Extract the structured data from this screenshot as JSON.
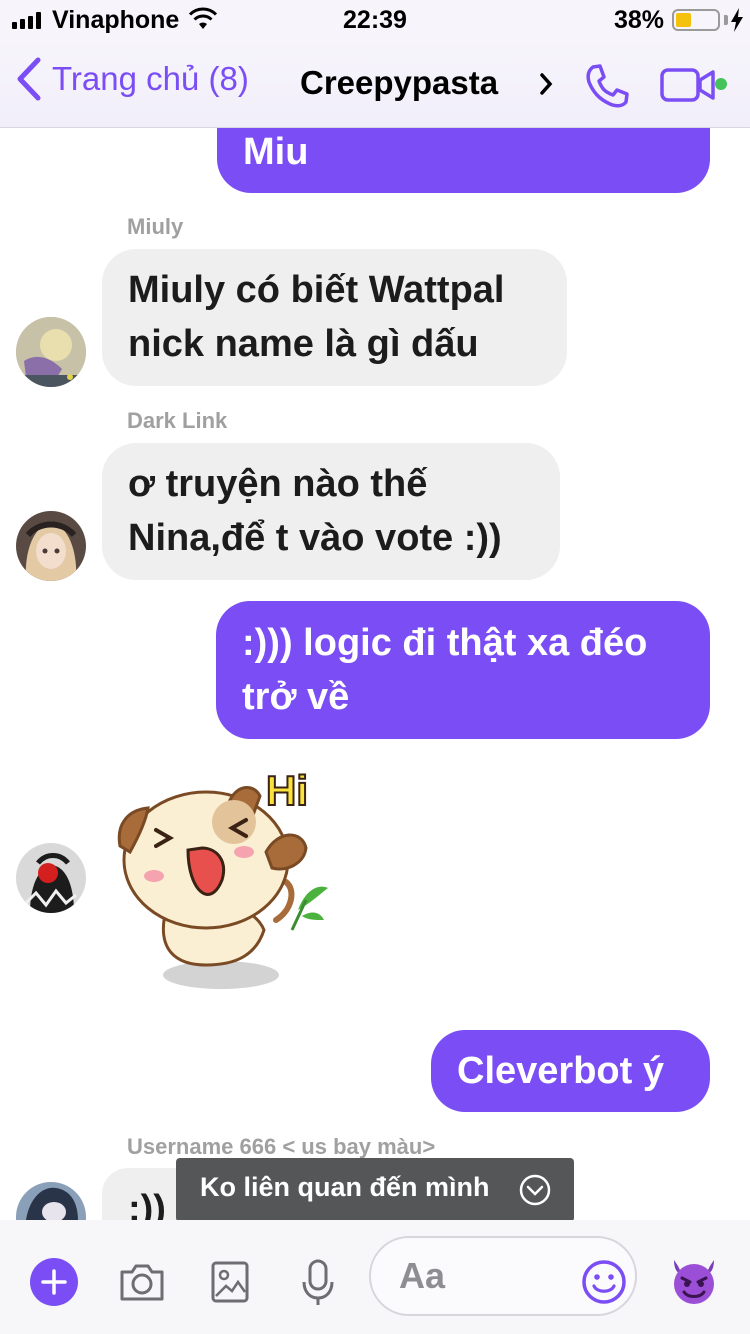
{
  "status_bar": {
    "carrier": "Vinaphone",
    "time": "22:39",
    "battery_percent": "38%",
    "battery_level": 0.38
  },
  "nav": {
    "back_label": "Trang chủ (8)",
    "title": "Creepypasta"
  },
  "messages": [
    {
      "type": "outgoing",
      "text": "Miu"
    },
    {
      "type": "incoming",
      "sender": "Miuly",
      "line1": "Miuly có biết Wattpal",
      "line2": "nick name là gì dấu"
    },
    {
      "type": "incoming",
      "sender": "Dark Link",
      "line1": "ơ truyện nào thế",
      "line2": "Nina,để t vào vote :))"
    },
    {
      "type": "outgoing",
      "line1": ":))) logic đi thật xa đéo",
      "line2": "trở về"
    },
    {
      "type": "sticker",
      "text": "Hi"
    },
    {
      "type": "outgoing",
      "text": "Cleverbot ý"
    },
    {
      "type": "incoming",
      "sender": "Username  666 < us bay màu>",
      "text": ":))"
    }
  ],
  "toast": {
    "text": "Ko liên quan đến mình"
  },
  "composer": {
    "placeholder": "Aa"
  },
  "colors": {
    "accent": "#7b4ef5",
    "incoming_bg": "#efefef",
    "online": "#43c35a"
  }
}
